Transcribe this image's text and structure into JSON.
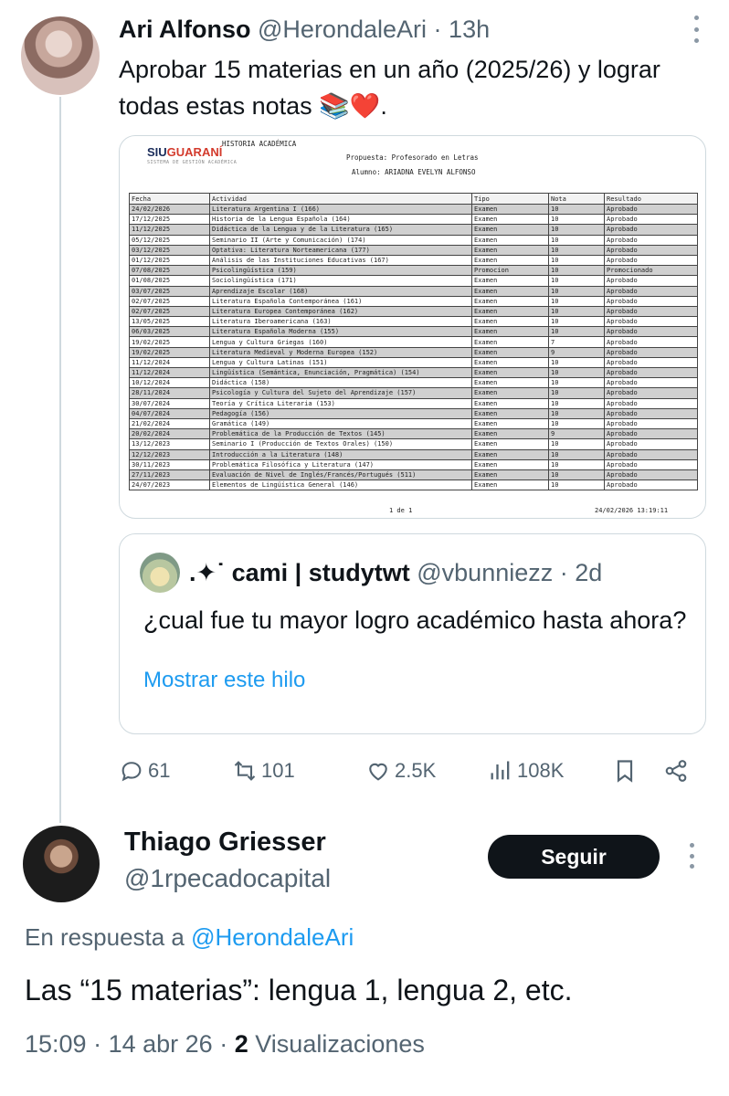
{
  "post": {
    "author_name": "Ari Alfonso",
    "author_handle": "@HerondaleAri",
    "separator": "·",
    "time": "13h",
    "text": "Aprobar 15 materias en un año (2025/26) y lograr todas estas notas",
    "emoji": "📚❤️",
    "text_end": "."
  },
  "document": {
    "logo_siu": "SIU",
    "logo_guarani": "GUARANÍ",
    "logo_sub": "SISTEMA DE GESTIÓN ACADÉMICA",
    "heading": "HISTORIA ACADÉMICA",
    "propuesta": "Propuesta: Profesorado en Letras",
    "alumno": "Alumno: ARIADNA EVELYN ALFONSO",
    "columns": [
      "Fecha",
      "Actividad",
      "Tipo",
      "Nota",
      "Resultado"
    ],
    "rows": [
      [
        "24/02/2026",
        "Literatura Argentina I (166)",
        "Examen",
        "10",
        "Aprobado"
      ],
      [
        "17/12/2025",
        "Historia de la Lengua Española (164)",
        "Examen",
        "10",
        "Aprobado"
      ],
      [
        "11/12/2025",
        "Didáctica de la Lengua y de la Literatura (165)",
        "Examen",
        "10",
        "Aprobado"
      ],
      [
        "05/12/2025",
        "Seminario II (Arte y Comunicación) (174)",
        "Examen",
        "10",
        "Aprobado"
      ],
      [
        "03/12/2025",
        "Optativa: Literatura Norteamericana (177)",
        "Examen",
        "10",
        "Aprobado"
      ],
      [
        "01/12/2025",
        "Análisis de las Instituciones Educativas (167)",
        "Examen",
        "10",
        "Aprobado"
      ],
      [
        "07/08/2025",
        "Psicolingüística (159)",
        "Promocion",
        "10",
        "Promocionado"
      ],
      [
        "01/08/2025",
        "Sociolingüística (171)",
        "Examen",
        "10",
        "Aprobado"
      ],
      [
        "03/07/2025",
        "Aprendizaje Escolar (168)",
        "Examen",
        "10",
        "Aprobado"
      ],
      [
        "02/07/2025",
        "Literatura Española Contemporánea (161)",
        "Examen",
        "10",
        "Aprobado"
      ],
      [
        "02/07/2025",
        "Literatura Europea Contemporánea (162)",
        "Examen",
        "10",
        "Aprobado"
      ],
      [
        "13/05/2025",
        "Literatura Iberoamericana (163)",
        "Examen",
        "10",
        "Aprobado"
      ],
      [
        "06/03/2025",
        "Literatura Española Moderna (155)",
        "Examen",
        "10",
        "Aprobado"
      ],
      [
        "19/02/2025",
        "Lengua y Cultura Griegas (160)",
        "Examen",
        "7",
        "Aprobado"
      ],
      [
        "19/02/2025",
        "Literatura Medieval y Moderna Europea (152)",
        "Examen",
        "9",
        "Aprobado"
      ],
      [
        "11/12/2024",
        "Lengua y Cultura Latinas (151)",
        "Examen",
        "10",
        "Aprobado"
      ],
      [
        "11/12/2024",
        "Lingüística (Semántica, Enunciación, Pragmática) (154)",
        "Examen",
        "10",
        "Aprobado"
      ],
      [
        "10/12/2024",
        "Didáctica (158)",
        "Examen",
        "10",
        "Aprobado"
      ],
      [
        "28/11/2024",
        "Psicología y Cultura del Sujeto del Aprendizaje (157)",
        "Examen",
        "10",
        "Aprobado"
      ],
      [
        "30/07/2024",
        "Teoría y Crítica Literaria (153)",
        "Examen",
        "10",
        "Aprobado"
      ],
      [
        "04/07/2024",
        "Pedagogía (156)",
        "Examen",
        "10",
        "Aprobado"
      ],
      [
        "21/02/2024",
        "Gramática (149)",
        "Examen",
        "10",
        "Aprobado"
      ],
      [
        "20/02/2024",
        "Problemática de la Producción de Textos (145)",
        "Examen",
        "9",
        "Aprobado"
      ],
      [
        "13/12/2023",
        "Seminario I (Producción de Textos Orales) (150)",
        "Examen",
        "10",
        "Aprobado"
      ],
      [
        "12/12/2023",
        "Introducción a la Literatura (148)",
        "Examen",
        "10",
        "Aprobado"
      ],
      [
        "30/11/2023",
        "Problemática Filosófica y Literatura (147)",
        "Examen",
        "10",
        "Aprobado"
      ],
      [
        "27/11/2023",
        "Evaluación de Nivel de Inglés/Francés/Portugués (511)",
        "Examen",
        "10",
        "Aprobado"
      ],
      [
        "24/07/2023",
        "Elementos de Lingüística General (146)",
        "Examen",
        "10",
        "Aprobado"
      ]
    ],
    "footer_page": "1 de 1",
    "footer_date": "24/02/2026 13:19:11"
  },
  "quote": {
    "author_prefix": ".✦˙",
    "author_name": "cami | studytwt",
    "author_handle": "@vbunniezz",
    "separator": "·",
    "time": "2d",
    "text": "¿cual fue tu mayor logro académico hasta ahora?",
    "link": "Mostrar este hilo"
  },
  "actions": {
    "replies": "61",
    "retweets": "101",
    "likes": "2.5K",
    "views": "108K"
  },
  "reply": {
    "author_name": "Thiago Griesser",
    "author_handle": "@1rpecadocapital",
    "follow_label": "Seguir",
    "in_reply_prefix": "En respuesta a",
    "in_reply_handle": "@HerondaleAri",
    "text": "Las “15 materias”: lengua 1, lengua 2, etc.",
    "time": "15:09",
    "date": "14 abr 26",
    "views_count": "2",
    "views_label": "Visualizaciones"
  },
  "colors": {
    "link": "#1d9bf0",
    "muted": "#536471",
    "text": "#0f1419",
    "border": "#cfd9de"
  }
}
